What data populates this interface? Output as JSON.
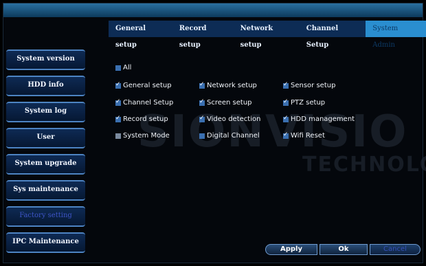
{
  "tabs": [
    {
      "label": "General setup"
    },
    {
      "label": "Record setup"
    },
    {
      "label": "Network setup"
    },
    {
      "label": "Channel Setup"
    },
    {
      "label": "System Admin"
    }
  ],
  "sidebar": {
    "items": [
      {
        "label": "System version"
      },
      {
        "label": "HDD info"
      },
      {
        "label": "System log"
      },
      {
        "label": "User"
      },
      {
        "label": "System upgrade"
      },
      {
        "label": "Sys maintenance"
      },
      {
        "label": "Factory setting"
      },
      {
        "label": "IPC Maintenance"
      }
    ]
  },
  "permissions": {
    "all": {
      "label": "All",
      "checked": false
    },
    "items": [
      {
        "label": "General setup",
        "checked": true
      },
      {
        "label": "Network setup",
        "checked": true
      },
      {
        "label": "Sensor setup",
        "checked": true
      },
      {
        "label": "Channel Setup",
        "checked": true
      },
      {
        "label": "Screen setup",
        "checked": true
      },
      {
        "label": "PTZ setup",
        "checked": true
      },
      {
        "label": "Record setup",
        "checked": true
      },
      {
        "label": "Video detection",
        "checked": true
      },
      {
        "label": "HDD management",
        "checked": true
      },
      {
        "label": "System Mode",
        "checked": false
      },
      {
        "label": "Digital Channel",
        "checked": false
      },
      {
        "label": "Wifi Reset",
        "checked": true
      }
    ]
  },
  "buttons": {
    "apply": "Apply",
    "ok": "Ok",
    "cancel": "Cancel"
  },
  "watermark": {
    "line1": "SIONVISIO",
    "line2": "TECHNOLO"
  },
  "colors": {
    "tab_active": "#2a8ed0",
    "checkbox": "#3a6fb0",
    "sidebar_border": "#4d84c3"
  }
}
